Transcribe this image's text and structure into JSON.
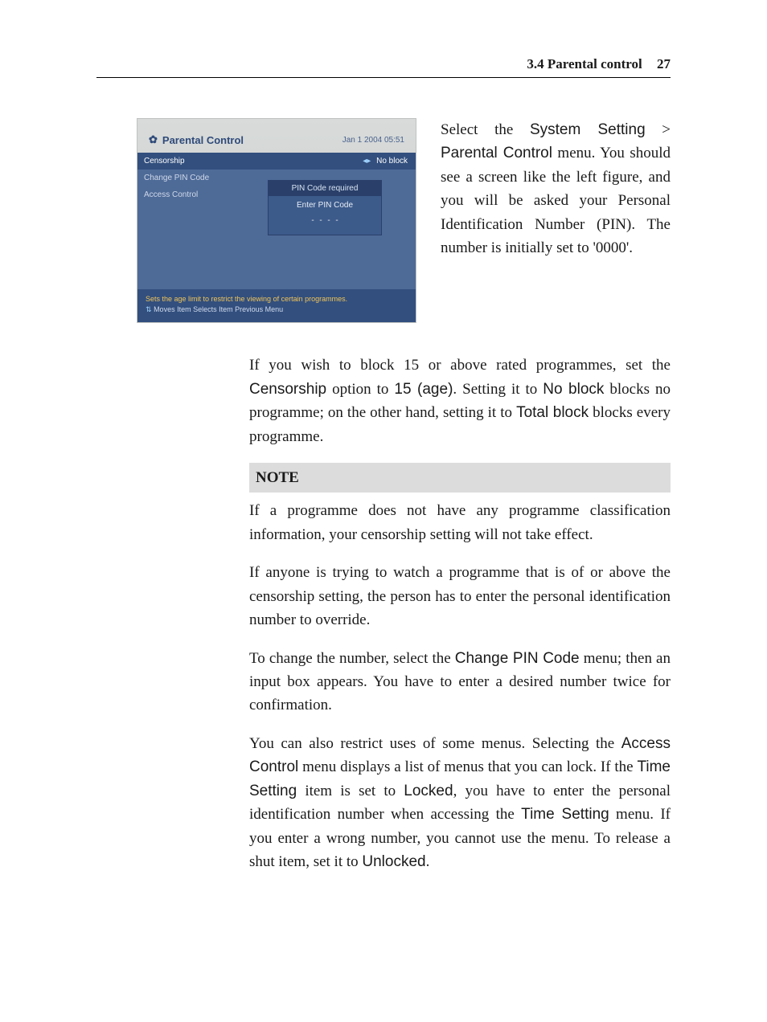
{
  "header": {
    "section": "3.4 Parental control",
    "page": "27"
  },
  "screenshot": {
    "title": "Parental Control",
    "timestamp": "Jan 1 2004 05:51",
    "menu": {
      "items": [
        "Censorship",
        "Change PIN Code",
        "Access Control"
      ],
      "selected_value": "No block"
    },
    "pinbox": {
      "title": "PIN Code required",
      "subtitle": "Enter PIN Code"
    },
    "footer": {
      "hint": "Sets the age limit to restrict the viewing of certain programmes.",
      "nav": "Moves Item    Selects Item    Previous Menu"
    }
  },
  "side_para": {
    "pre": "Select the ",
    "m1": "System Setting",
    "gt": " > ",
    "m2": "Parental Control",
    "post": " menu.  You should see a screen like the left figure, and you will be asked your Personal Identification Number (PIN).  The number is initially set to '0000'."
  },
  "para1": {
    "a": "If you wish to block 15 or above rated programmes, set the ",
    "b": "Censorship",
    "c": " option to ",
    "d": "15 (age)",
    "e": ". Setting it to ",
    "f": "No block",
    "g": " blocks no programme; on the other hand, setting it to ",
    "h": "Total block",
    "i": " blocks every programme."
  },
  "note": {
    "heading": "NOTE",
    "body": "If a programme does not have any programme classification information, your censorship setting will not take effect."
  },
  "para2": "If anyone is trying to watch a programme that is of or above the censorship setting, the person has to enter the personal identification number to override.",
  "para3": {
    "a": "To change the number, select the ",
    "b": "Change PIN Code",
    "c": " menu; then an input box appears.  You have to enter a desired number twice for confirmation."
  },
  "para4": {
    "a": "You can also restrict uses of some menus. Selecting the ",
    "b": "Access Control",
    "c": " menu displays a list of menus that you can lock. If the ",
    "d": "Time Setting",
    "e": " item is set to ",
    "f": "Locked",
    "g": ", you have to enter the personal identification number when accessing the ",
    "h": "Time Setting",
    "i": " menu. If you enter a wrong number, you cannot use the menu. To release a shut item, set it to ",
    "j": "Unlocked",
    "k": "."
  }
}
